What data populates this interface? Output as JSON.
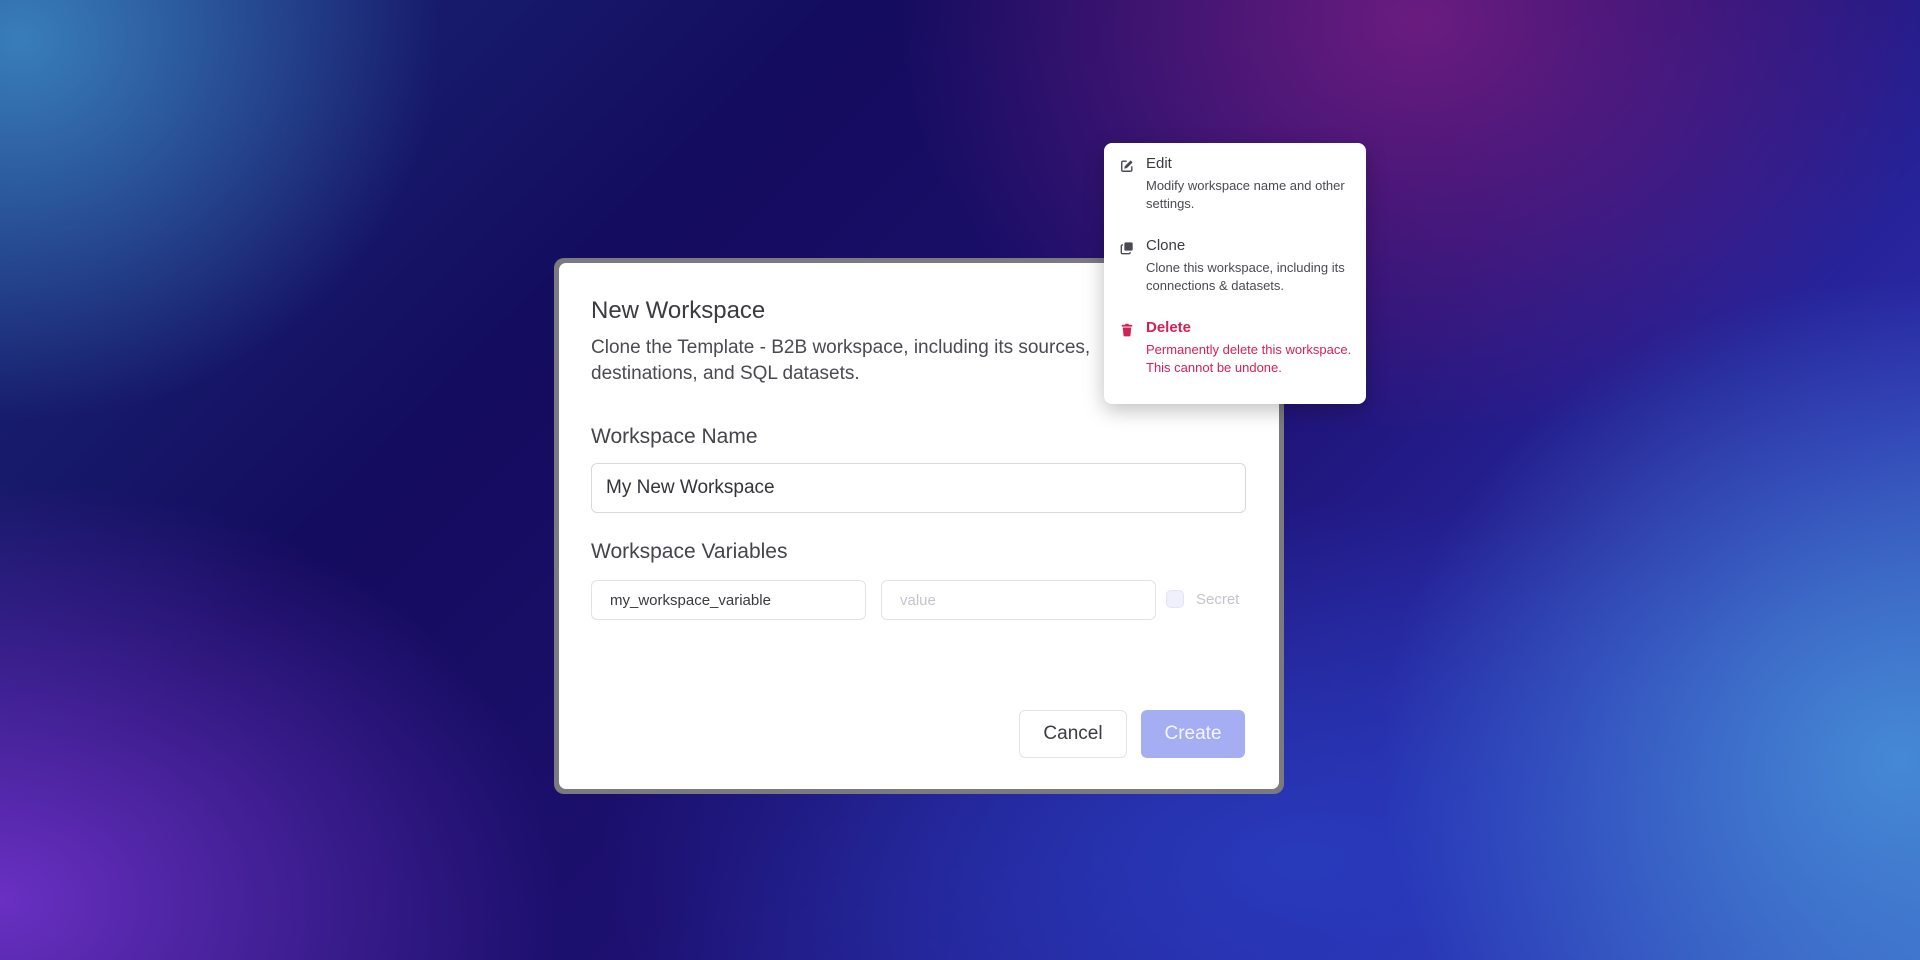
{
  "modal": {
    "title": "New Workspace",
    "description": "Clone the Template - B2B workspace, including its sources, destinations, and SQL datasets.",
    "name_label": "Workspace Name",
    "name_value": "My New Workspace",
    "variables_label": "Workspace Variables",
    "variable_key_value": "my_workspace_variable",
    "variable_value_placeholder": "value",
    "secret_label": "Secret",
    "cancel_label": "Cancel",
    "create_label": "Create"
  },
  "menu": {
    "items": [
      {
        "label": "Edit",
        "description": "Modify workspace name and other settings.",
        "icon": "edit-icon"
      },
      {
        "label": "Clone",
        "description": "Clone this workspace, including its connections & datasets.",
        "icon": "clone-icon"
      },
      {
        "label": "Delete",
        "description": "Permanently delete this workspace. This cannot be undone.",
        "icon": "trash-icon"
      }
    ]
  },
  "colors": {
    "accent_disabled": "#a6aef3",
    "danger": "#d61f55"
  }
}
